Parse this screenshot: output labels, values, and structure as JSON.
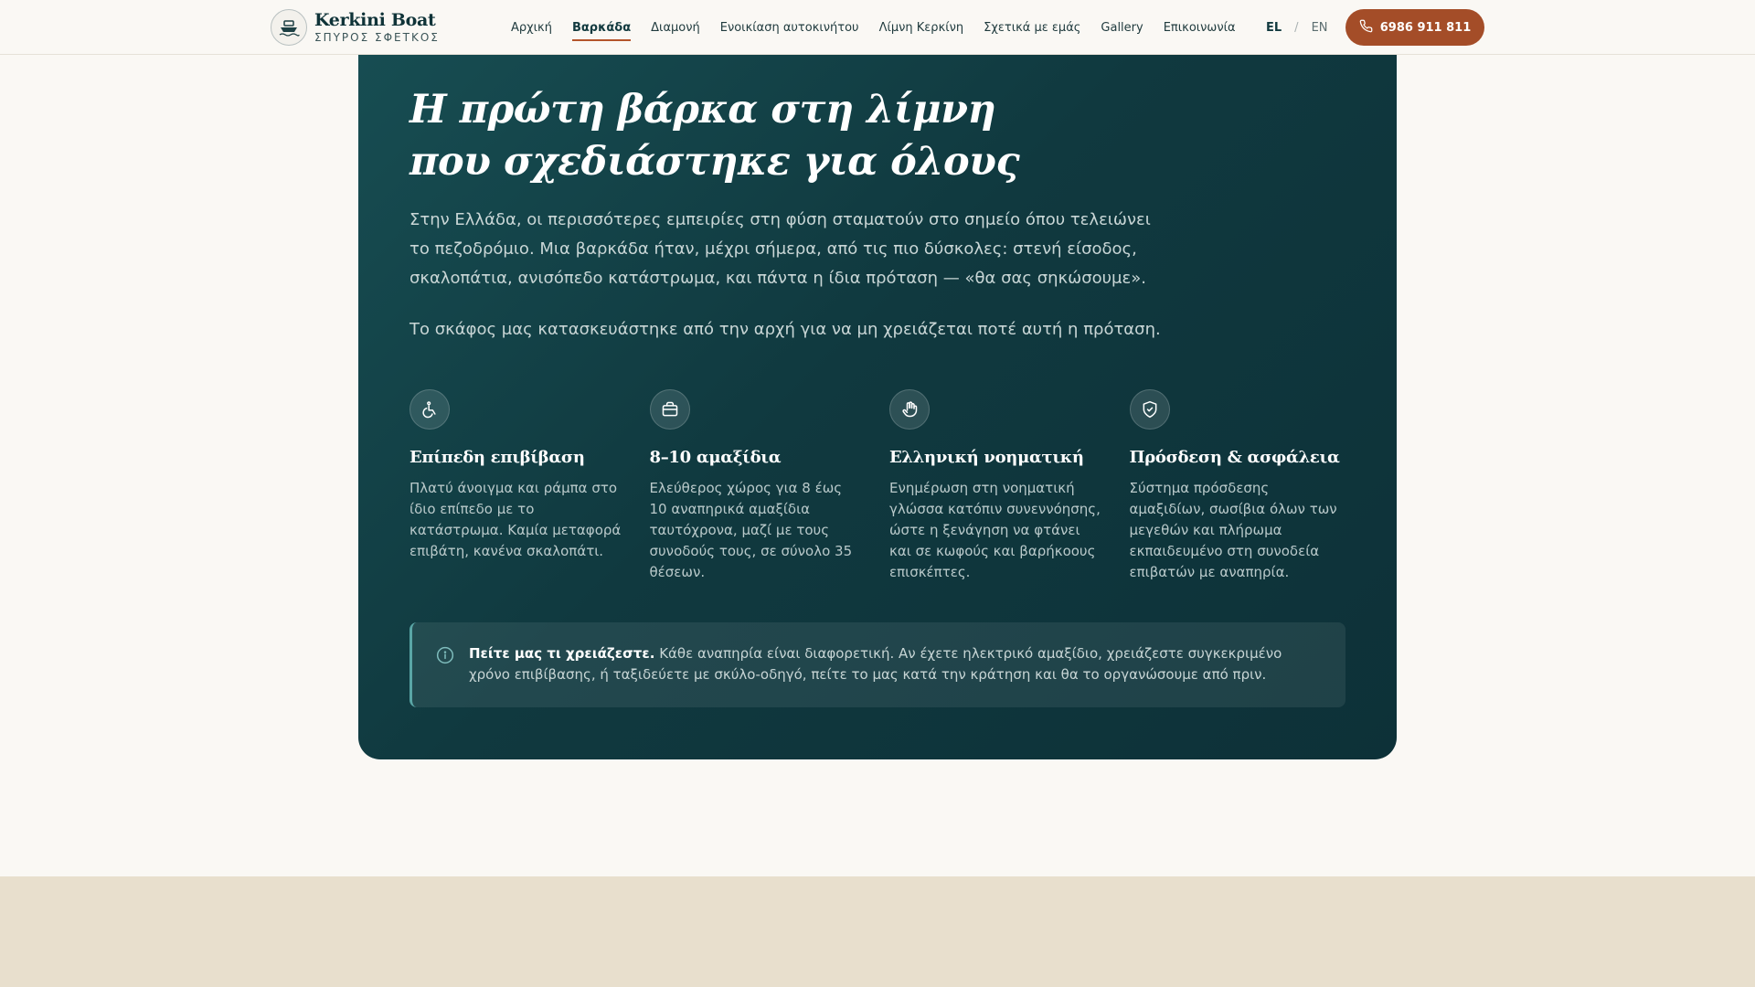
{
  "header": {
    "brand_name": "Kerkini Boat",
    "brand_sub": "ΣΠΥΡΟΣ ΣΦΕΤΚΟΣ",
    "nav": [
      {
        "label": "Αρχική",
        "active": false
      },
      {
        "label": "Βαρκάδα",
        "active": true
      },
      {
        "label": "Διαμονή",
        "active": false
      },
      {
        "label": "Ενοικίαση αυτοκινήτου",
        "active": false
      },
      {
        "label": "Λίμνη Κερκίνη",
        "active": false
      },
      {
        "label": "Σχετικά με εμάς",
        "active": false
      },
      {
        "label": "Gallery",
        "active": false
      },
      {
        "label": "Επικοινωνία",
        "active": false
      }
    ],
    "lang_el": "EL",
    "lang_sep": "/",
    "lang_en": "EN",
    "phone": "6986 911 811",
    "phone_icon": "phone-icon",
    "accent_color": "#a44d28"
  },
  "hero": {
    "headline_line1": "Η πρώτη βάρκα στη λίμνη",
    "headline_line2": "που σχεδιάστηκε για όλους",
    "paragraph1": "Στην Ελλάδα, οι περισσότερες εμπειρίες στη φύση σταματούν στο σημείο όπου τελειώνει το πεζοδρόμιο. Μια βαρκάδα ήταν, μέχρι σήμερα, από τις πιο δύσκολες: στενή είσοδος, σκαλοπάτια, ανισόπεδο κατάστρωμα, και πάντα η ίδια πρόταση — «θα σας σηκώσουμε».",
    "paragraph2": "Το σκάφος μας κατασκευάστηκε από την αρχή για να μη χρειάζεται ποτέ αυτή η πρόταση."
  },
  "features": [
    {
      "icon": "wheelchair-icon",
      "title": "Επίπεδη επιβίβαση",
      "desc": "Πλατύ άνοιγμα και ράμπα στο ίδιο επίπεδο με το κατάστρωμα. Καμία μεταφορά επιβάτη, κανένα σκαλοπάτι."
    },
    {
      "icon": "briefcase-icon",
      "title": "8–10 αμαξίδια",
      "desc": "Ελεύθερος χώρος για 8 έως 10 αναπηρικά αμαξίδια ταυτόχρονα, μαζί με τους συνοδούς τους, σε σύνολο 35 θέσεων."
    },
    {
      "icon": "hand-icon",
      "title": "Ελληνική νοηματική",
      "desc": "Ενημέρωση στη νοηματική γλώσσα κατόπιν συνεννόησης, ώστε η ξενάγηση να φτάνει και σε κωφούς και βαρήκοους επισκέπτες."
    },
    {
      "icon": "shield-check-icon",
      "title": "Πρόσδεση & ασφάλεια",
      "desc": "Σύστημα πρόσδεσης αμαξιδίων, σωσίβια όλων των μεγεθών και πλήρωμα εκπαιδευμένο στη συνοδεία επιβατών με αναπηρία."
    }
  ],
  "note": {
    "icon": "info-icon",
    "bold": "Πείτε μας τι χρειάζεστε.",
    "text": " Κάθε αναπηρία είναι διαφορετική. Αν έχετε ηλεκτρικό αμαξίδιο, χρειάζεστε συγκεκριμένο χρόνο επιβίβασης, ή ταξιδεύετε με σκύλο-οδηγό, πείτε το μας κατά την κράτηση και θα το οργανώσουμε από πριν."
  }
}
